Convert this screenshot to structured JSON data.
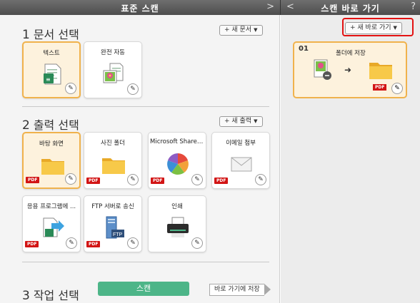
{
  "title_left": "표준 스캔",
  "title_right": "스캔 바로 가기",
  "nav_right": ">",
  "nav_left": "<",
  "help": "?",
  "section1": {
    "num": "1",
    "title": "문서 선택",
    "button": "+ 새 문서",
    "cards": [
      {
        "label": "텍스트",
        "selected": true,
        "icon": "text-document-icon"
      },
      {
        "label": "완전 자동",
        "selected": false,
        "icon": "auto-document-icon"
      }
    ]
  },
  "section2": {
    "num": "2",
    "title": "출력 선택",
    "button": "+ 새 출력",
    "cards": [
      {
        "label": "바탕 화면",
        "selected": true,
        "icon": "folder-icon",
        "pdf": "PDF"
      },
      {
        "label": "사진 폴더",
        "selected": false,
        "icon": "folder-icon",
        "pdf": "PDF"
      },
      {
        "label": "Microsoft SharePo...",
        "selected": false,
        "icon": "sharepoint-icon",
        "pdf": "PDF"
      },
      {
        "label": "이메일 첨부",
        "selected": false,
        "icon": "mail-icon",
        "pdf": "PDF"
      },
      {
        "label": "응용 프로그램에 ...",
        "selected": false,
        "icon": "application-icon",
        "pdf": "PDF"
      },
      {
        "label": "FTP 서버로 송신",
        "selected": false,
        "icon": "ftp-server-icon",
        "pdf": "PDF"
      },
      {
        "label": "인쇄",
        "selected": false,
        "icon": "printer-icon"
      }
    ]
  },
  "section3": {
    "num": "3",
    "title": "작업 선택",
    "scan_button": "스캔",
    "save_shortcut": "바로 가기에 저장"
  },
  "shortcuts": {
    "new_button": "+ 새 바로 가기",
    "items": [
      {
        "num": "01",
        "label": "폴더에 저장",
        "pdf": "PDF"
      }
    ]
  },
  "colors": {
    "selected_border": "#f0b24c",
    "selected_fill": "#fdf2dd",
    "scan_button": "#4db588",
    "highlight": "#e31212"
  }
}
